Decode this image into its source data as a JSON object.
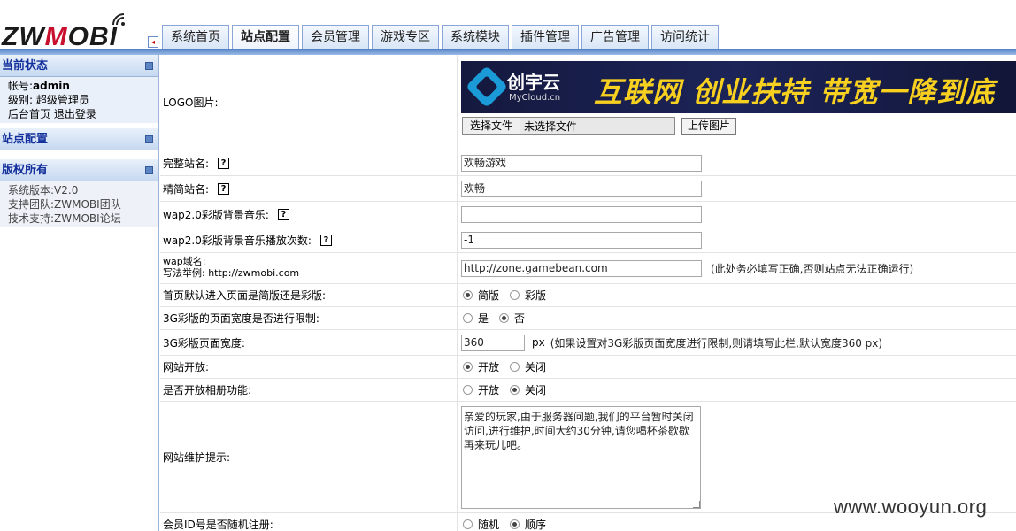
{
  "header": {
    "logo_text_black": "ZW",
    "logo_text_red": "M",
    "logo_text_rest": "OBI",
    "collapse_glyph": "◂",
    "tabs": [
      {
        "label": "系统首页",
        "active": false
      },
      {
        "label": "站点配置",
        "active": true
      },
      {
        "label": "会员管理",
        "active": false
      },
      {
        "label": "游戏专区",
        "active": false
      },
      {
        "label": "系统模块",
        "active": false
      },
      {
        "label": "插件管理",
        "active": false
      },
      {
        "label": "广告管理",
        "active": false
      },
      {
        "label": "访问统计",
        "active": false
      }
    ]
  },
  "sidebar": {
    "status": {
      "title": "当前状态",
      "account_label": "帐号:",
      "account": "admin",
      "level": "级别: 超级管理员",
      "home_link": "后台首页",
      "logout_link": "退出登录"
    },
    "site_config": {
      "title": "站点配置"
    },
    "copyright": {
      "title": "版权所有",
      "version": "系统版本:V2.0",
      "team": "支持团队:ZWMOBI团队",
      "support": "技术支持:ZWMOBI论坛"
    }
  },
  "banner": {
    "brand": "创宇云",
    "brand_sub": "MyCloud.cn",
    "slogan": "互联网 创业扶持 带宽一降到底"
  },
  "form": {
    "logo_label": "LOGO图片:",
    "file_button": "选择文件",
    "file_none": "未选择文件",
    "upload_button": "上传图片",
    "help_glyph": "?",
    "full_name_label": "完整站名:",
    "full_name_value": "欢畅游戏",
    "short_name_label": "精简站名:",
    "short_name_value": "欢畅",
    "wap_music_label": "wap2.0彩版背景音乐:",
    "wap_music_value": "",
    "wap_music_count_label": "wap2.0彩版背景音乐播放次数:",
    "wap_music_count_value": "-1",
    "wap_domain_label": "wap域名:",
    "wap_domain_example": "写法举例: http://zwmobi.com",
    "wap_domain_value": "http://zone.gamebean.com",
    "wap_domain_note": "(此处务必填写正确,否则站点无法正确运行)",
    "default_page_label": "首页默认进入页面是简版还是彩版:",
    "opt_simple": "简版",
    "opt_color": "彩版",
    "limit_width_label": "3G彩版的页面宽度是否进行限制:",
    "opt_yes": "是",
    "opt_no": "否",
    "width_label": "3G彩版页面宽度:",
    "width_value": "360",
    "width_unit": "px",
    "width_note": "(如果设置对3G彩版页面宽度进行限制,则请填写此栏,默认宽度360 px)",
    "site_open_label": "网站开放:",
    "opt_open": "开放",
    "opt_close": "关闭",
    "album_label": "是否开放相册功能:",
    "maintenance_label": "网站维护提示:",
    "maintenance_value": "亲爱的玩家,由于服务器问题,我们的平台暂时关闭访问,进行维护,时间大约30分钟,请您喝杯茶歇歇再来玩儿吧。",
    "member_id_label": "会员ID号是否随机注册:",
    "opt_random": "随机",
    "opt_order": "顺序"
  },
  "watermark": "www.wooyun.org"
}
